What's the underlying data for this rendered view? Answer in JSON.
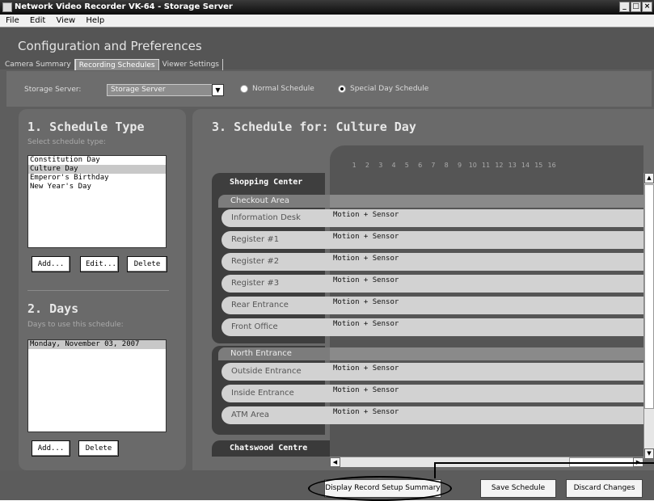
{
  "window": {
    "title": "Network Video Recorder VK-64 - Storage Server",
    "controls": [
      "_",
      "□",
      "×"
    ]
  },
  "menu": [
    "File",
    "Edit",
    "View",
    "Help"
  ],
  "header": {
    "title": "Configuration and Preferences",
    "tabs": [
      {
        "label": "Camera Summary",
        "active": false
      },
      {
        "label": "Recording Schedules",
        "active": true
      },
      {
        "label": "Viewer Settings",
        "active": false
      }
    ]
  },
  "storage": {
    "label": "Storage Server:",
    "value": "Storage Server",
    "normal_schedule": "Normal Schedule",
    "special_schedule": "Special Day Schedule",
    "selected": "Special Day Schedule"
  },
  "schedule_type": {
    "title": "1. Schedule Type",
    "subtitle": "Select schedule type:",
    "items": [
      "Constitution Day",
      "Culture Day",
      "Emperor's Birthday",
      "New Year's Day"
    ],
    "selected": "Culture Day",
    "add": "Add...",
    "edit": "Edit...",
    "delete": "Delete"
  },
  "days": {
    "title": "2. Days",
    "subtitle": "Days to use this schedule:",
    "items": [
      "Monday, November 03, 2007"
    ],
    "add": "Add...",
    "delete": "Delete"
  },
  "schedule": {
    "title": "3. Schedule for: Culture Day",
    "hours": [
      "1",
      "2",
      "3",
      "4",
      "5",
      "6",
      "7",
      "8",
      "9",
      "10",
      "11",
      "12",
      "13",
      "14",
      "15",
      "16"
    ],
    "groups": [
      {
        "name": "Shopping Center",
        "subgroup": "Checkout Area",
        "rows": [
          {
            "label": "Information Desk",
            "mode": "Motion + Sensor"
          },
          {
            "label": "Register #1",
            "mode": "Motion + Sensor"
          },
          {
            "label": "Register #2",
            "mode": "Motion + Sensor"
          },
          {
            "label": "Register #3",
            "mode": "Motion + Sensor"
          },
          {
            "label": "Rear Entrance",
            "mode": "Motion + Sensor"
          },
          {
            "label": "Front Office",
            "mode": "Motion + Sensor"
          }
        ]
      },
      {
        "subgroup": "North Entrance",
        "rows": [
          {
            "label": "Outside Entrance",
            "mode": "Motion + Sensor"
          },
          {
            "label": "Inside Entrance",
            "mode": "Motion + Sensor"
          },
          {
            "label": "ATM Area",
            "mode": "Motion + Sensor"
          }
        ]
      },
      {
        "name": "Chatswood Centre"
      }
    ]
  },
  "footer": {
    "display_summary": "Display Record Setup Summary",
    "save": "Save Schedule",
    "discard": "Discard Changes"
  }
}
